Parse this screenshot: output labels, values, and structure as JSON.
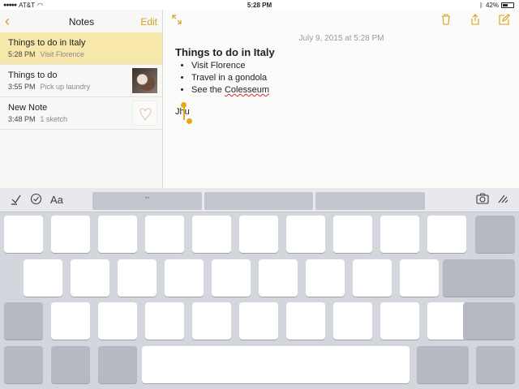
{
  "status_bar": {
    "carrier": "AT&T",
    "time": "5:28 PM",
    "battery": "42%"
  },
  "sidebar": {
    "title": "Notes",
    "edit_label": "Edit",
    "notes": [
      {
        "title": "Things to do in Italy",
        "time": "5:28 PM",
        "preview": "Visit Florence",
        "selected": true
      },
      {
        "title": "Things to do",
        "time": "3:55 PM",
        "preview": "Pick up laundry",
        "thumbnail": "cat-photo"
      },
      {
        "title": "New Note",
        "time": "3:48 PM",
        "preview": "1 sketch",
        "thumbnail": "sketch"
      }
    ]
  },
  "note": {
    "date": "July 9, 2015 at 5:28 PM",
    "title": "Things to do in Italy",
    "items": [
      "Visit Florence",
      "Travel in a gondola",
      "See the Colesseum"
    ],
    "typed_text": "Jhu"
  },
  "keyboard": {
    "toolbar_left_icons": [
      "checklist-icon",
      "checkmark-circle-icon",
      "format-text-icon"
    ],
    "format_label": "Aa",
    "suggestions": [
      "\"\"",
      "",
      ""
    ],
    "toolbar_right_icons": [
      "camera-icon",
      "sketch-pen-icon"
    ]
  },
  "colors": {
    "accent": "#d4a017",
    "selected_row": "#f7e7ab",
    "keyboard_bg": "#d3d6dc"
  }
}
